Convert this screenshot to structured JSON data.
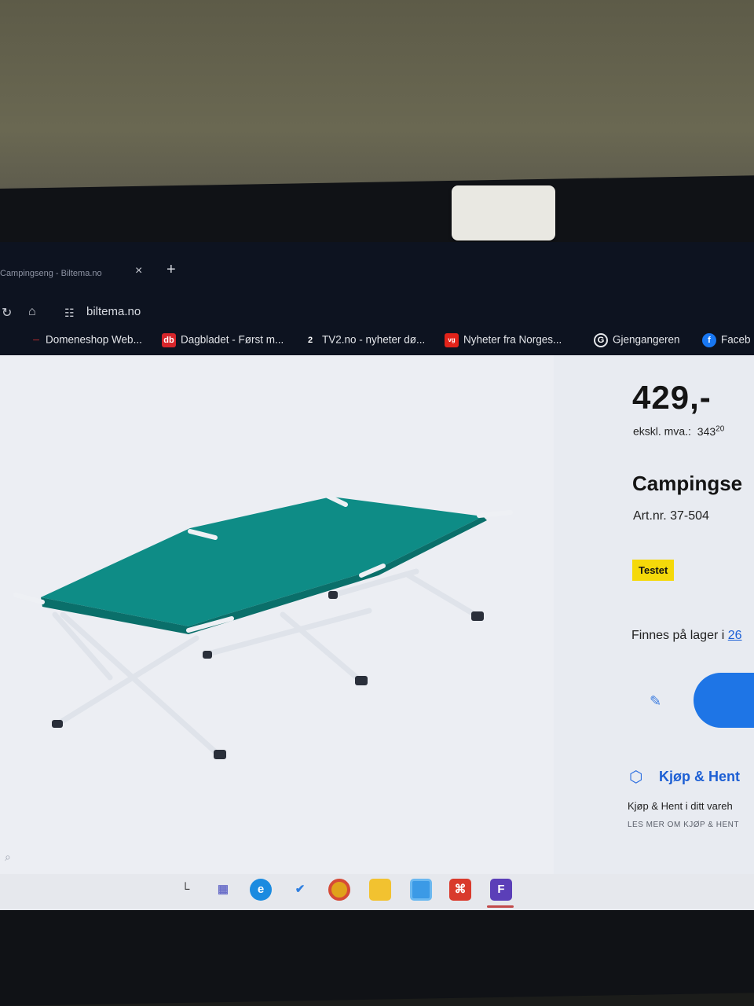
{
  "browser": {
    "tab_title": "Campingseng - Biltema.no",
    "tab_close": "×",
    "new_tab": "+",
    "url": "biltema.no",
    "bookmarks": [
      {
        "label": "Domeneshop Web...",
        "icon": "domeneshop-icon",
        "color": "#b3261e"
      },
      {
        "label": "Dagbladet - Først m...",
        "icon_text": "db",
        "color": "#d7262b"
      },
      {
        "label": "TV2.no - nyheter dø...",
        "icon_text": "2",
        "color": "#0d1320"
      },
      {
        "label": "Nyheter fra Norges...",
        "icon_text": "vg",
        "color": "#e2231a"
      },
      {
        "label": "Gjengangeren",
        "icon_text": "G",
        "color": "#0d1320"
      },
      {
        "label": "Faceb",
        "icon_text": "f",
        "color": "#1877f2"
      }
    ]
  },
  "product": {
    "price": "429,-",
    "excl_label": "ekskl. mva.:",
    "excl_value": "343",
    "excl_cents": "20",
    "title": "Campingse",
    "art_nr": "Art.nr. 37-504",
    "badge": "Testet",
    "stock_text": "Finnes på lager i",
    "stock_link": "26",
    "kjop_hent_title": "Kjøp & Hent",
    "kjop_hent_text": "Kjøp & Hent i ditt vareh",
    "kjop_hent_link": "LES MER OM KJØP & HENT"
  },
  "colors": {
    "accent": "#1e75e6",
    "badge": "#f5d90a",
    "cot_fabric": "#0e8c86"
  },
  "taskbar": {
    "icons": [
      "file-icon",
      "app-icon",
      "edge-icon",
      "todo-icon",
      "chrome-icon",
      "folder-icon",
      "window-icon",
      "pdf-icon",
      "app-active-icon"
    ]
  }
}
